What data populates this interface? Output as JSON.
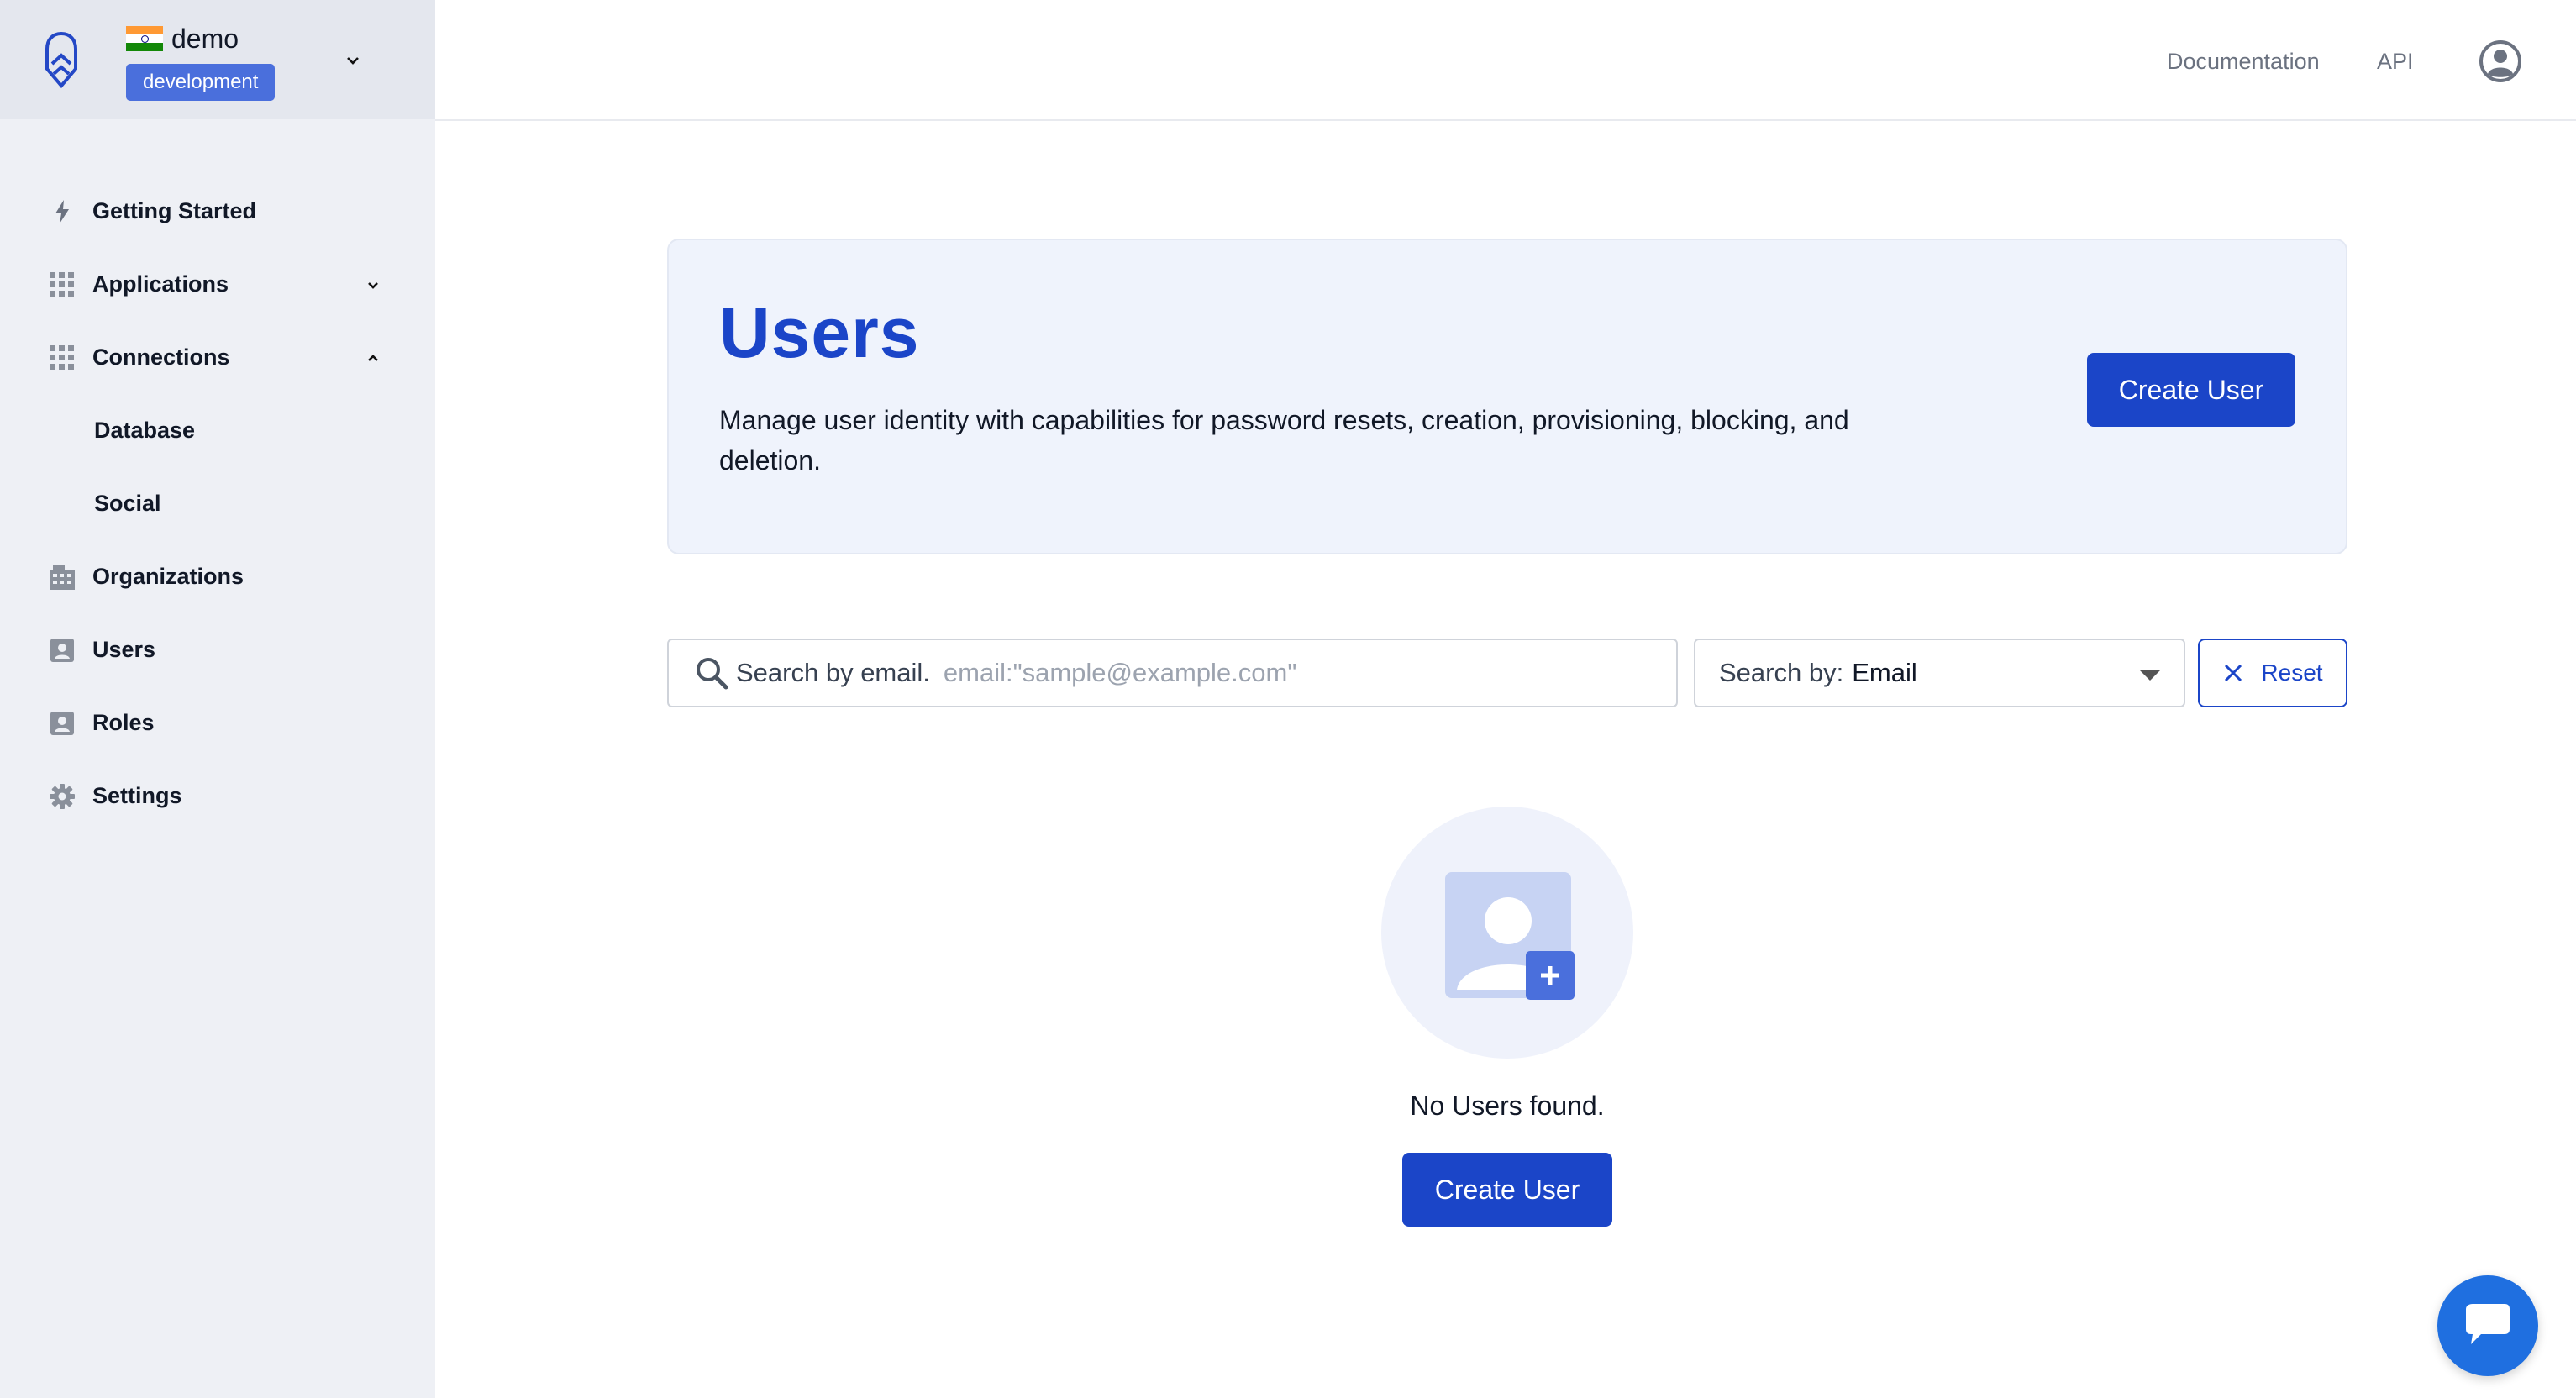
{
  "tenant": {
    "name": "demo",
    "environment": "development"
  },
  "sidebar": {
    "items": [
      {
        "label": "Getting Started",
        "icon": "bolt-icon"
      },
      {
        "label": "Applications",
        "icon": "grid-icon",
        "expanded": false
      },
      {
        "label": "Connections",
        "icon": "grid-icon",
        "expanded": true,
        "children": [
          {
            "label": "Database"
          },
          {
            "label": "Social"
          }
        ]
      },
      {
        "label": "Organizations",
        "icon": "building-icon"
      },
      {
        "label": "Users",
        "icon": "user-card-icon"
      },
      {
        "label": "Roles",
        "icon": "user-card-icon"
      },
      {
        "label": "Settings",
        "icon": "gear-icon"
      }
    ]
  },
  "topbar": {
    "documentation": "Documentation",
    "api": "API"
  },
  "hero": {
    "title": "Users",
    "description": "Manage user identity with capabilities for password resets, creation, provisioning, blocking, and deletion.",
    "create_button": "Create User"
  },
  "search": {
    "label": "Search by email.",
    "placeholder": "email:\"sample@example.com\"",
    "value": ""
  },
  "search_by": {
    "prefix": "Search by:",
    "selected": "Email"
  },
  "reset": {
    "label": "Reset"
  },
  "empty_state": {
    "message": "No Users found.",
    "create_button": "Create User"
  },
  "colors": {
    "primary": "#1b45c8",
    "env_badge": "#4a6fdc",
    "chat": "#1f6fe0"
  }
}
